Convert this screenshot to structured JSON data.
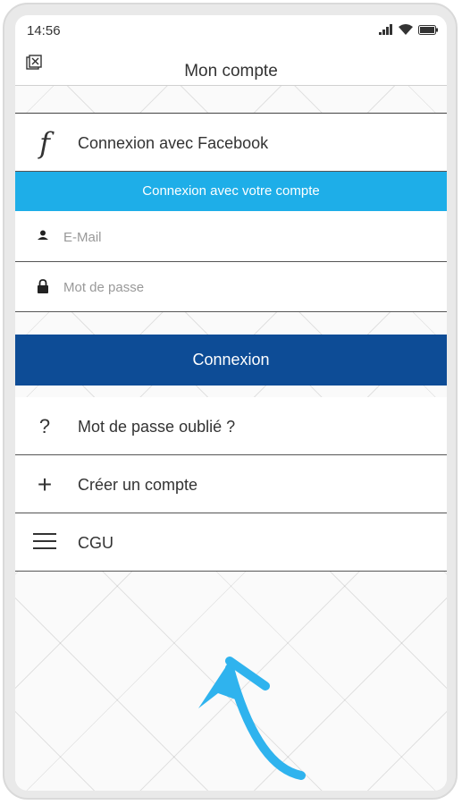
{
  "status_bar": {
    "time": "14:56"
  },
  "header": {
    "title": "Mon compte",
    "close_icon": "close-window-icon"
  },
  "facebook": {
    "label": "Connexion avec Facebook",
    "icon": "facebook-f-icon"
  },
  "account_banner": {
    "label": "Connexion avec votre compte"
  },
  "form": {
    "email_placeholder": "E-Mail",
    "password_placeholder": "Mot de passe",
    "submit_label": "Connexion"
  },
  "menu": [
    {
      "label": "Mot de passe oublié ?",
      "icon": "question-icon"
    },
    {
      "label": "Créer un compte",
      "icon": "plus-icon"
    },
    {
      "label": "CGU",
      "icon": "hamburger-icon"
    }
  ],
  "colors": {
    "accent_cyan": "#1eaee8",
    "primary_blue": "#0d4c96",
    "annotation_arrow": "#2fb3ee"
  }
}
